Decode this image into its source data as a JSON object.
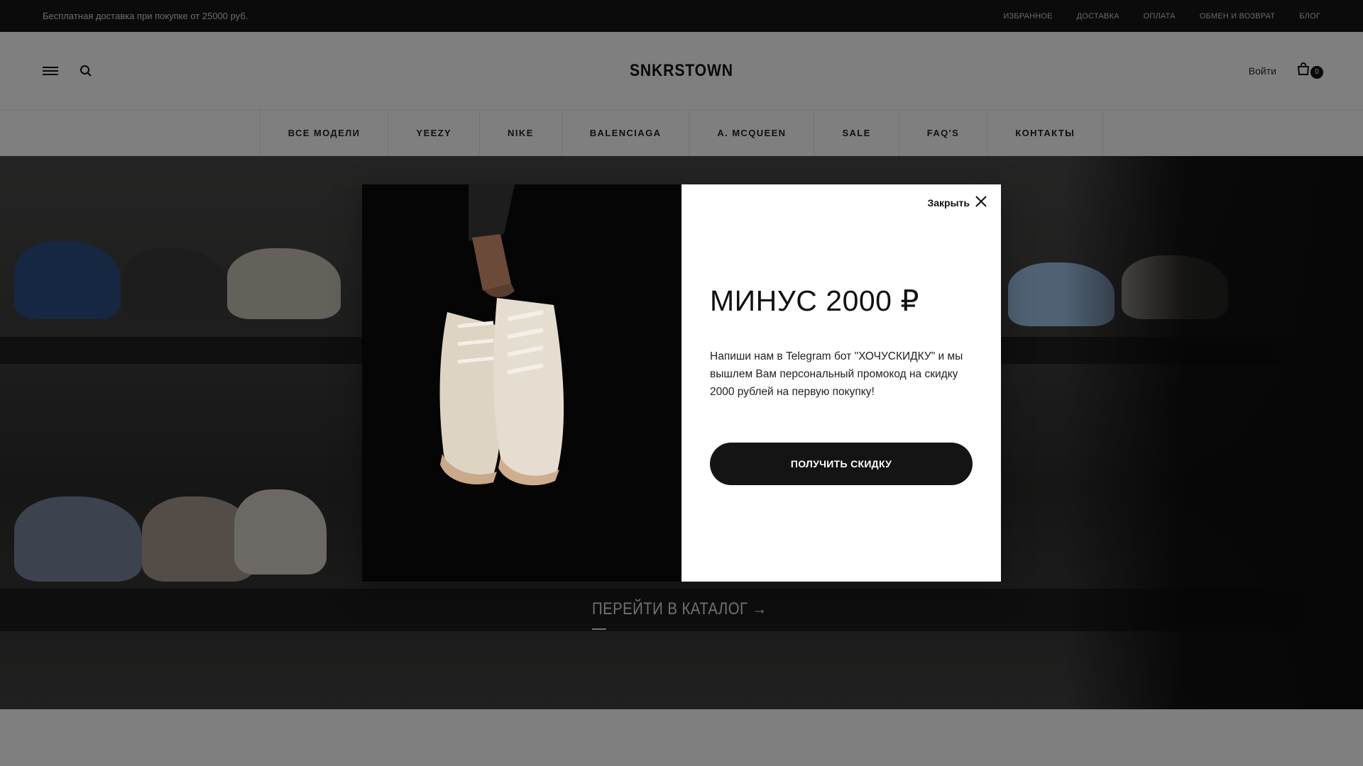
{
  "topbar": {
    "promo": "Бесплатная доставка при покупке от 25000 руб.",
    "links": [
      "ИЗБРАННОЕ",
      "ДОСТАВКА",
      "ОПЛАТА",
      "ОБМЕН И ВОЗВРАТ",
      "БЛОГ"
    ]
  },
  "header": {
    "logo": "SNKRSTOWN",
    "login": "Войти",
    "cart_count": "0",
    "icons": [
      "menu-icon",
      "search-icon",
      "cart-icon"
    ]
  },
  "catnav": {
    "items": [
      "ВСЕ МОДЕЛИ",
      "YEEZY",
      "NIKE",
      "BALENCIAGA",
      "A. MCQUEEN",
      "SALE",
      "FAQ'S",
      "КОНТАКТЫ"
    ]
  },
  "hero": {
    "cta": "ПЕРЕЙТИ В КАТАЛОГ →"
  },
  "modal": {
    "close_label": "Закрыть",
    "title": "МИНУС 2000 ₽",
    "text": "Напиши нам в Telegram бот \"ХОЧУСКИДКУ\" и мы вышлем Вам персональный промокод на скидку 2000 рублей на первую покупку!",
    "button": "ПОЛУЧИТЬ СКИДКУ"
  },
  "colors": {
    "dark": "#141414",
    "topbar_bg": "#161616",
    "overlay": "rgba(0,0,0,0.5)"
  }
}
